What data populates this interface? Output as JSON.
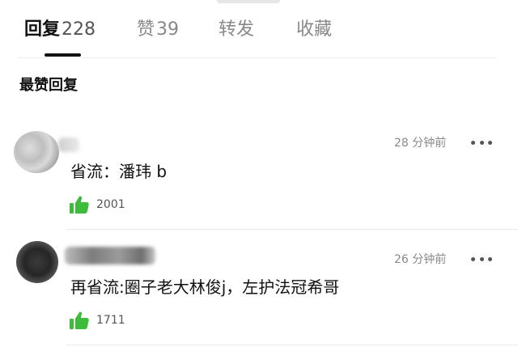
{
  "tabs": [
    {
      "label": "回复",
      "count": "228",
      "active": true
    },
    {
      "label": "赞",
      "count": "39",
      "active": false
    },
    {
      "label": "转发",
      "count": "",
      "active": false
    },
    {
      "label": "收藏",
      "count": "",
      "active": false
    }
  ],
  "section_title": "最赞回复",
  "comments": [
    {
      "time": "28 分钟前",
      "text": "省流：潘玮 b",
      "likes": "2001"
    },
    {
      "time": "26 分钟前",
      "text": "再省流:圈子老大林俊j，左护法冠希哥",
      "likes": "1711"
    }
  ],
  "colors": {
    "like_icon": "#3dbb3a",
    "text": "#111111",
    "muted": "#8a8a8a",
    "divider": "#ececec"
  },
  "icons": {
    "like": "thumbs-up-icon",
    "more": "more-dots-icon",
    "avatar": "avatar"
  }
}
